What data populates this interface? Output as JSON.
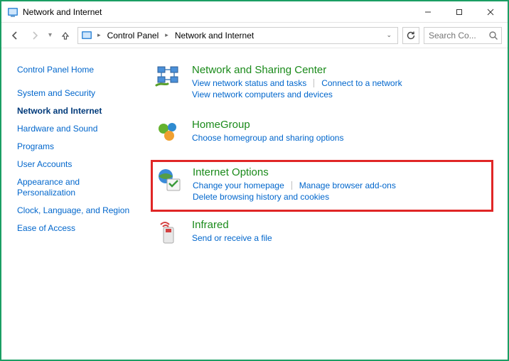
{
  "window": {
    "title": "Network and Internet"
  },
  "breadcrumb": {
    "items": [
      "Control Panel",
      "Network and Internet"
    ]
  },
  "search": {
    "placeholder": "Search Co..."
  },
  "sidebar": {
    "items": [
      {
        "label": "Control Panel Home"
      },
      {
        "label": "System and Security"
      },
      {
        "label": "Network and Internet",
        "active": true
      },
      {
        "label": "Hardware and Sound"
      },
      {
        "label": "Programs"
      },
      {
        "label": "User Accounts"
      },
      {
        "label": "Appearance and Personalization"
      },
      {
        "label": "Clock, Language, and Region"
      },
      {
        "label": "Ease of Access"
      }
    ]
  },
  "categories": {
    "network_sharing": {
      "title": "Network and Sharing Center",
      "links": {
        "status": "View network status and tasks",
        "connect": "Connect to a network",
        "computers": "View network computers and devices"
      }
    },
    "homegroup": {
      "title": "HomeGroup",
      "links": {
        "choose": "Choose homegroup and sharing options"
      }
    },
    "internet_options": {
      "title": "Internet Options",
      "links": {
        "homepage": "Change your homepage",
        "addons": "Manage browser add-ons",
        "delete": "Delete browsing history and cookies"
      }
    },
    "infrared": {
      "title": "Infrared",
      "links": {
        "send": "Send or receive a file"
      }
    }
  }
}
